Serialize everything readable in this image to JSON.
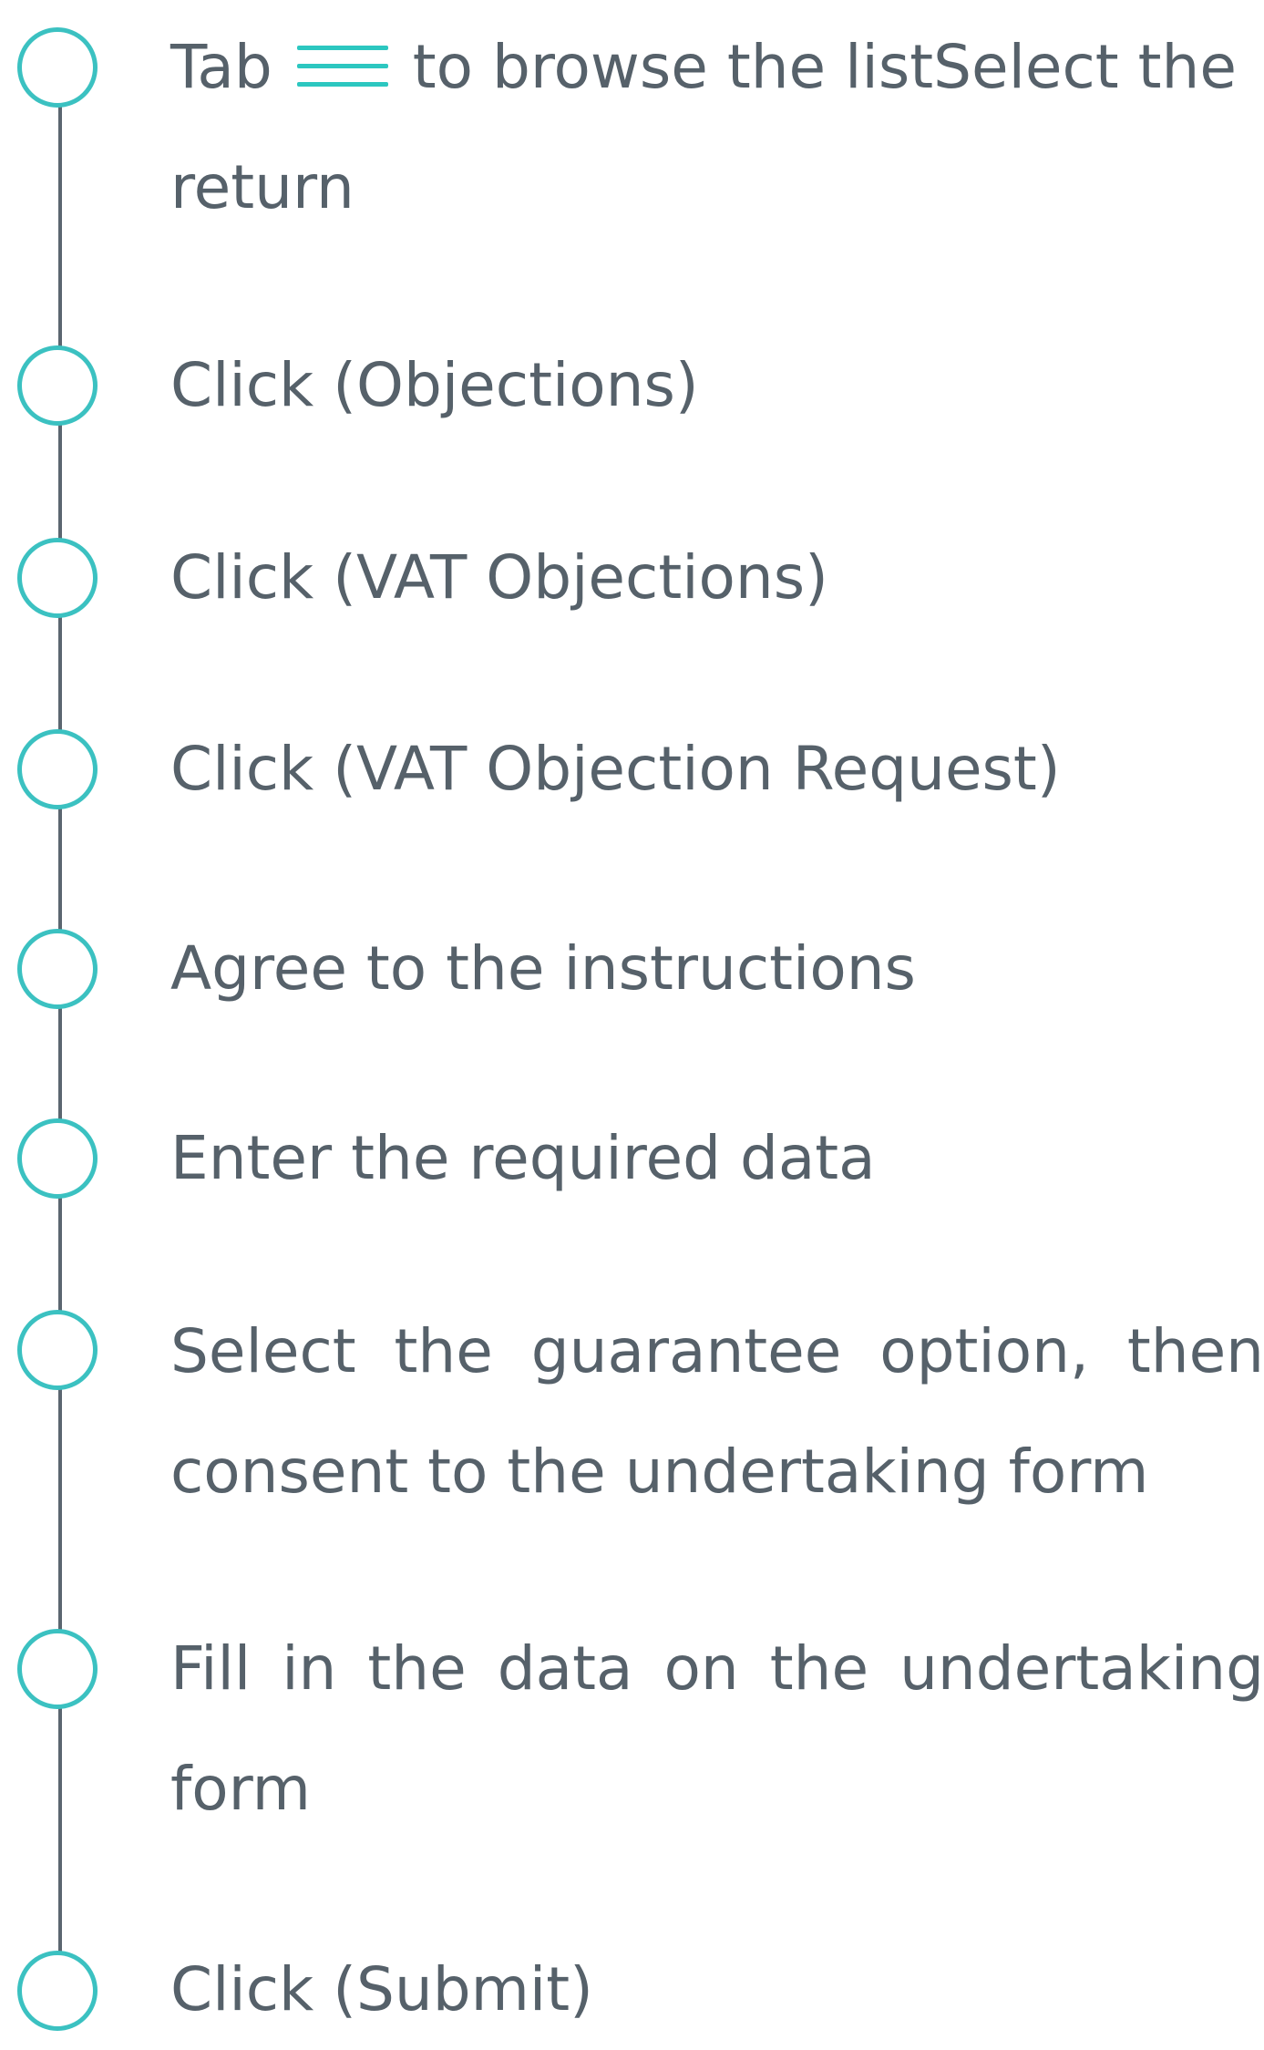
{
  "steps": [
    {
      "text_before_icon": "Tab",
      "icon": "hamburger-menu-icon",
      "text_after_icon": "to browse the listSelect the return"
    },
    {
      "text": "Click (Objections)"
    },
    {
      "text": "Click (VAT Objections)"
    },
    {
      "text": "Click (VAT Objection Request)"
    },
    {
      "text": "Agree to the instructions"
    },
    {
      "text": "Enter the required data"
    },
    {
      "text": "Select the guarantee option, then consent to the undertaking form"
    },
    {
      "text": "Fill in the data on the undertaking form"
    },
    {
      "text": "Click (Submit)"
    }
  ],
  "colors": {
    "text": "#56616a",
    "circle_border": "#3bc1c1",
    "line": "#5b6670",
    "icon": "#2cc7c0"
  }
}
